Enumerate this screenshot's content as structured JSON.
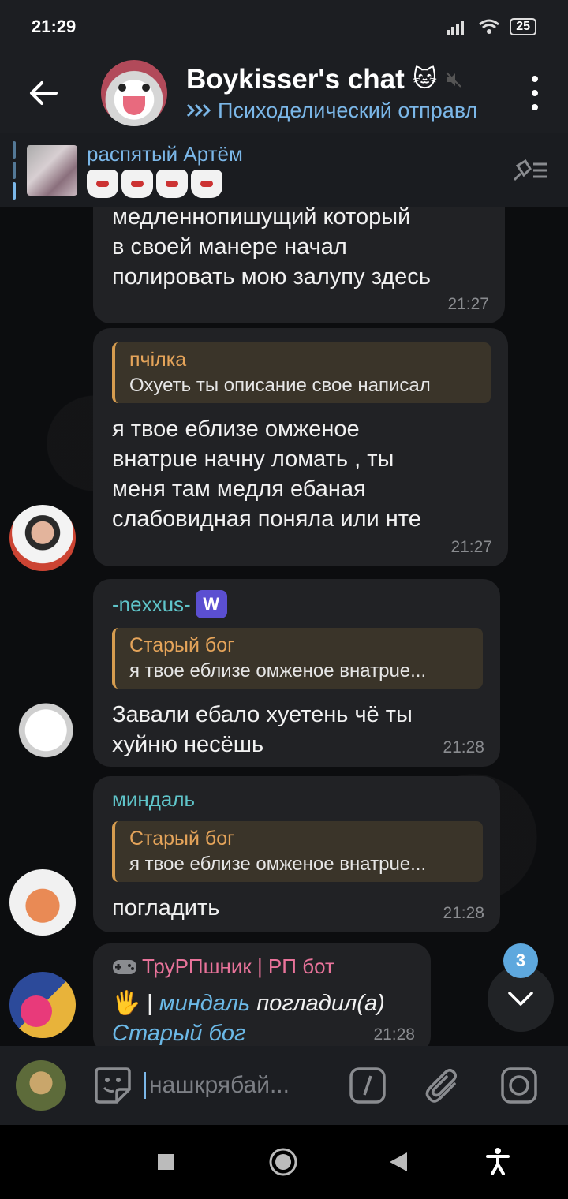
{
  "status_bar": {
    "time": "21:29",
    "battery": "25"
  },
  "header": {
    "title": "Boykisser's chat",
    "title_emoji": "🐱",
    "subtitle": "Психоделический отправл"
  },
  "pinned": {
    "author": "распятый Артём"
  },
  "messages": [
    {
      "text_lines": [
        "медленнопишущий который",
        "в своей манере начал",
        "полировать мою залупу здесь"
      ],
      "time": "21:27"
    },
    {
      "reply_author": "пчілка",
      "reply_text": "Охуеть ты описание свое написал",
      "text_lines": [
        "я твое еблизе омженое",
        "внатрue начну ломать , ты",
        "меня там медля ебаная",
        "слабовидная поняла или нте"
      ],
      "time": "21:27"
    },
    {
      "sender": "-nexxus-",
      "sender_color": "#5fc4c9",
      "reply_author": "Старый бог",
      "reply_text": "я твое еблизе омженое внатрue...",
      "text_lines": [
        "Завали ебало хуетень чё ты",
        "хуйню несёшь"
      ],
      "time": "21:28"
    },
    {
      "sender": "миндаль",
      "sender_color": "#5fc4c9",
      "reply_author": "Старый бог",
      "reply_text": "я твое еблизе омженое внатрue...",
      "text_lines": [
        "погладить"
      ],
      "time": "21:28"
    },
    {
      "sender": "ТруРПшник | РП бот",
      "sender_color": "#e8739a",
      "action_emoji": "🖐",
      "action_separator": "|",
      "action_actor": "миндаль",
      "action_verb": "погладил(а)",
      "action_target": "Старый бог",
      "time": "21:28"
    }
  ],
  "scroll_badge": "3",
  "input": {
    "placeholder": "нашкрябай..."
  },
  "colors": {
    "accent": "#7bb7e8",
    "bubble": "#212225",
    "reply_bar": "#d59c4f"
  }
}
